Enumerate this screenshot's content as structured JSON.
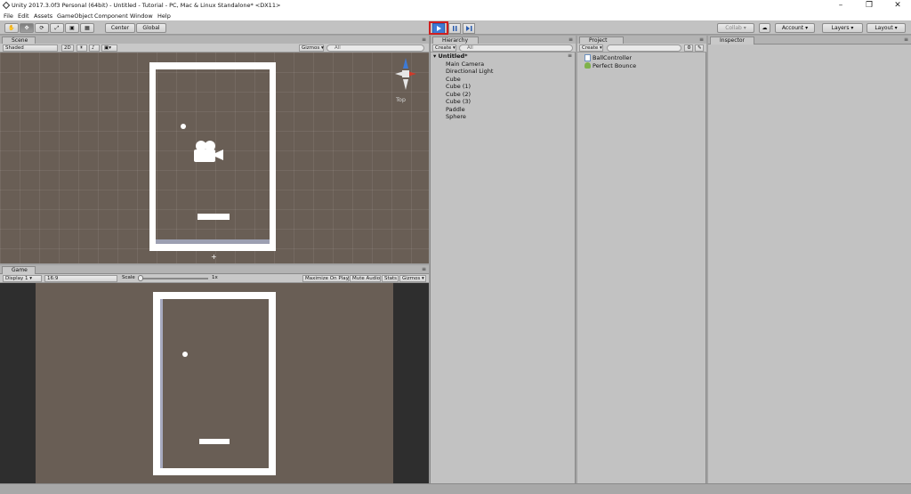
{
  "window": {
    "title": "Unity 2017.3.0f3 Personal (64bit) - Untitled - Tutorial - PC, Mac & Linux Standalone* <DX11>"
  },
  "menu": [
    "File",
    "Edit",
    "Assets",
    "GameObject",
    "Component",
    "Window",
    "Help"
  ],
  "toolbar": {
    "pivot": "Center",
    "space": "Global",
    "collab": "Collab",
    "account": "Account",
    "layers": "Layers",
    "layout": "Layout"
  },
  "scene": {
    "tab": "Scene",
    "shading": "Shaded",
    "mode_2d": "2D",
    "gizmos": "Gizmos",
    "search_placeholder": "All",
    "persp": "Top"
  },
  "game": {
    "tab": "Game",
    "display": "Display 1",
    "aspect": "16:9",
    "scale_label": "Scale",
    "scale_value": "1x",
    "maximize": "Maximize On Play",
    "mute": "Mute Audio",
    "stats": "Stats",
    "gizmos": "Gizmos"
  },
  "hierarchy": {
    "tab": "Hierarchy",
    "create": "Create",
    "search_placeholder": "All",
    "scene_name": "Untitled*",
    "items": [
      "Main Camera",
      "Directional Light",
      "Cube",
      "Cube (1)",
      "Cube (2)",
      "Cube (3)",
      "Paddle",
      "Sphere"
    ]
  },
  "project": {
    "tab": "Project",
    "create": "Create",
    "items": [
      "BallController",
      "Perfect Bounce"
    ]
  },
  "inspector": {
    "tab": "Inspector"
  },
  "colors": {
    "scene_bg": "#695e55",
    "panel_bg": "#a2a2a2",
    "play_active": "#3d7ad6",
    "highlight": "#d01f1f"
  }
}
